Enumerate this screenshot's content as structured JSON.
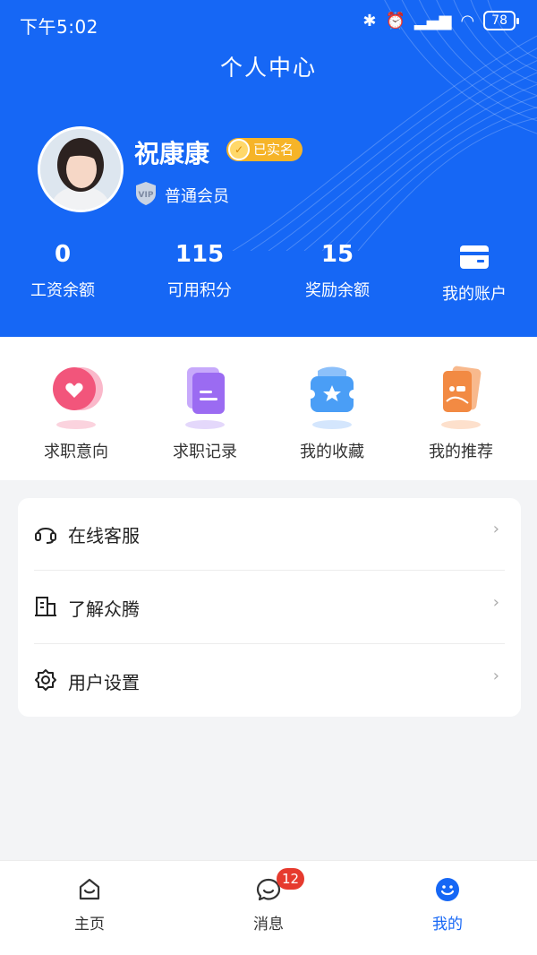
{
  "status_bar": {
    "time": "下午5:02",
    "battery": "78"
  },
  "header": {
    "title": "个人中心",
    "user_name": "祝康康",
    "verified_label": "已实名",
    "member_level": "普通会员",
    "vip_badge_text": "VIP"
  },
  "stats": [
    {
      "value": "0",
      "label": "工资余额"
    },
    {
      "value": "115",
      "label": "可用积分"
    },
    {
      "value": "15",
      "label": "奖励余额"
    },
    {
      "label": "我的账户",
      "icon": "wallet-icon"
    }
  ],
  "quick_actions": [
    {
      "label": "求职意向",
      "icon": "heart-icon",
      "color": "#f2557b"
    },
    {
      "label": "求职记录",
      "icon": "document-icon",
      "color": "#9b6bf2"
    },
    {
      "label": "我的收藏",
      "icon": "star-icon",
      "color": "#4a9ef6"
    },
    {
      "label": "我的推荐",
      "icon": "cards-icon",
      "color": "#f28a43"
    }
  ],
  "menu": [
    {
      "label": "在线客服",
      "icon": "headset-icon"
    },
    {
      "label": "了解众腾",
      "icon": "building-icon"
    },
    {
      "label": "用户设置",
      "icon": "gear-icon"
    }
  ],
  "tabbar": {
    "tabs": [
      {
        "label": "主页",
        "icon": "home-icon"
      },
      {
        "label": "消息",
        "icon": "chat-icon",
        "badge": "12"
      },
      {
        "label": "我的",
        "icon": "profile-icon",
        "active": true
      }
    ]
  },
  "colors": {
    "brand": "#1667f5",
    "badge": "#e63a2e",
    "verified": "#f6b428"
  }
}
